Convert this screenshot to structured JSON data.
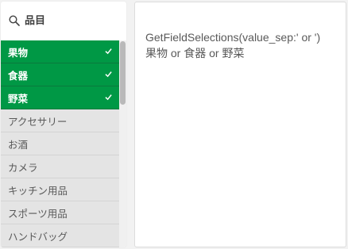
{
  "filter": {
    "title": "品目",
    "icon": "search-icon",
    "items": [
      {
        "label": "果物",
        "state": "selected"
      },
      {
        "label": "食器",
        "state": "selected"
      },
      {
        "label": "野菜",
        "state": "selected"
      },
      {
        "label": "アクセサリー",
        "state": "excluded"
      },
      {
        "label": "お酒",
        "state": "excluded"
      },
      {
        "label": "カメラ",
        "state": "excluded"
      },
      {
        "label": "キッチン用品",
        "state": "excluded"
      },
      {
        "label": "スポーツ用品",
        "state": "excluded"
      },
      {
        "label": "ハンドバッグ",
        "state": "excluded"
      }
    ]
  },
  "result": {
    "expression": "GetFieldSelections(value_sep:' or ')",
    "value": "果物 or 食器 or 野菜"
  },
  "colors": {
    "selected": "#009845",
    "excluded": "#e4e4e4",
    "text": "#595959"
  }
}
